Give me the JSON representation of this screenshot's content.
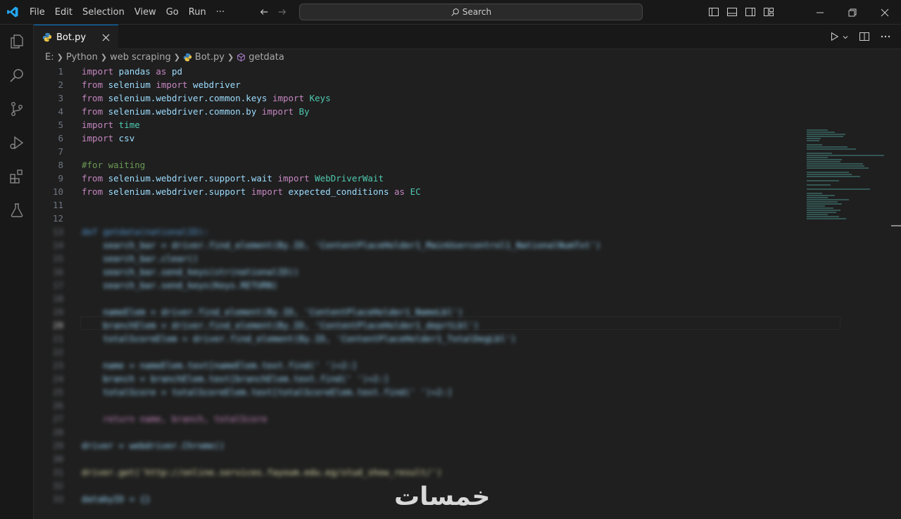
{
  "menu": [
    "File",
    "Edit",
    "Selection",
    "View",
    "Go",
    "Run",
    "···"
  ],
  "search": {
    "placeholder": "Search"
  },
  "tab": {
    "filename": "Bot.py"
  },
  "breadcrumb": {
    "drive": "E:",
    "folder1": "Python",
    "folder2": "web scraping",
    "file": "Bot.py",
    "symbol": "getdata"
  },
  "line_numbers": [
    "1",
    "2",
    "3",
    "4",
    "5",
    "6",
    "7",
    "8",
    "9",
    "10",
    "11",
    "12",
    "13",
    "14",
    "15",
    "16",
    "17",
    "18",
    "19",
    "20",
    "21",
    "22",
    "23",
    "24",
    "25",
    "26",
    "27",
    "28",
    "29",
    "30",
    "31",
    "32",
    "33"
  ],
  "active_line": "20",
  "code": {
    "l1": {
      "a": "import",
      "b": " pandas ",
      "c": "as",
      "d": " pd"
    },
    "l2": {
      "a": "from",
      "b": " selenium ",
      "c": "import",
      "d": " webdriver"
    },
    "l3": {
      "a": "from",
      "b": " selenium.webdriver.common.keys ",
      "c": "import",
      "d": " Keys"
    },
    "l4": {
      "a": "from",
      "b": " selenium.webdriver.common.by ",
      "c": "import",
      "d": " By"
    },
    "l5": {
      "a": "import",
      "b": " time"
    },
    "l6": {
      "a": "import",
      "b": " csv"
    },
    "l8": {
      "comment": "#for waiting"
    },
    "l9": {
      "a": "from",
      "b": " selenium.webdriver.support.wait ",
      "c": "import",
      "d": " WebDriverWait"
    },
    "l10": {
      "a": "from",
      "b": " selenium.webdriver.support ",
      "c": "import",
      "d": " expected_conditions ",
      "e": "as",
      "f": " EC"
    },
    "blurred": [
      "def getdata(nationalID):",
      "    search_bar = driver.find_element(By.ID, 'ContentPlaceHolder1_MainUsercontrol1_NationalNumTxt')",
      "    search_bar.clear()",
      "    search_bar.send_keys(str(nationalID))",
      "    search_bar.send_keys(Keys.RETURN)",
      "",
      "    nameElem = driver.find_element(By.ID, 'ContentPlaceHolder1_NameLbl')",
      "    branchElem = driver.find_element(By.ID, 'ContentPlaceHolder1_deprtLbl')",
      "    totalScoreElem = driver.find_element(By.ID, 'ContentPlaceHolder1_TotalDegLbl')",
      "",
      "    name = nameElem.text[nameElem.text.find(' ')+2:]",
      "    branch = branchElem.text[branchElem.text.find(' ')+2:]",
      "    totalScore = totalScoreElem.text[totalScoreElem.text.find(' ')+2:]",
      "",
      "    return name, branch, totalScore",
      "",
      "driver = webdriver.Chrome()",
      "",
      "driver.get('http://online.services.fayoum.edu.eg/stud_show_result/')",
      "",
      "databyID = {}"
    ]
  },
  "watermark": "خمسات",
  "colors": {
    "accent": "#0078d4",
    "keyword": "#c586c0",
    "variable": "#9cdcfe",
    "type": "#4ec9b0",
    "comment": "#6a9955"
  }
}
